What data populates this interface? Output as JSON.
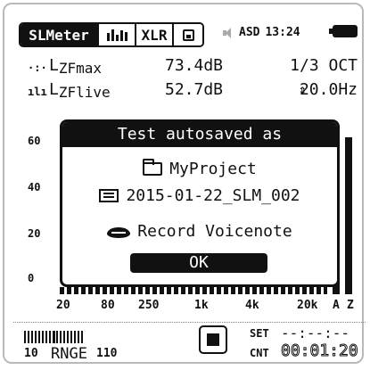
{
  "tabs": {
    "slmeter": "SLMeter",
    "xlr": "XLR"
  },
  "status": {
    "device": "ASD",
    "time": "13:24"
  },
  "readout": {
    "row1": {
      "symbol": "·:·",
      "label": "L",
      "sub": "ZFmax",
      "value": "73.4dB",
      "right": "1/3 OCT"
    },
    "row2": {
      "symbol": "ılı",
      "label": "L",
      "sub": "ZFlive",
      "value": "52.7dB",
      "arrows": "⇕",
      "right": "20.0Hz"
    }
  },
  "y_ticks": [
    "60",
    "40",
    "20",
    "0"
  ],
  "x_labels": [
    "20",
    "80",
    "250",
    "1k",
    "4k",
    "20k",
    "A",
    "Z"
  ],
  "dialog": {
    "title": "Test autosaved as",
    "project": "MyProject",
    "file": "2015-01-22_SLM_002",
    "voicenote": "Record Voicenote",
    "ok": "OK"
  },
  "bottom": {
    "range_low": "10",
    "range_label": "RNGE",
    "range_high": "110",
    "set_label": "SET",
    "set_value": "--:--:--",
    "cnt_label": "CNT",
    "cnt_value": "00:01:20"
  },
  "meters": {
    "a_level": 0.84,
    "z_level": 0.88
  },
  "colors": {
    "ink": "#111111",
    "background": "#ffffff",
    "frame": "#b9b9b9"
  }
}
